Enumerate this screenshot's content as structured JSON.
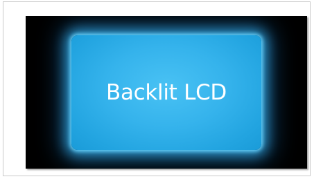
{
  "slide": {
    "panel_label": "Backlit LCD"
  },
  "colors": {
    "slide_background": "#000000",
    "panel_fill": "#35b3ec",
    "panel_glow": "#6ed7ff",
    "label_text": "#ffffff",
    "frame_border": "#c9c9c9"
  }
}
